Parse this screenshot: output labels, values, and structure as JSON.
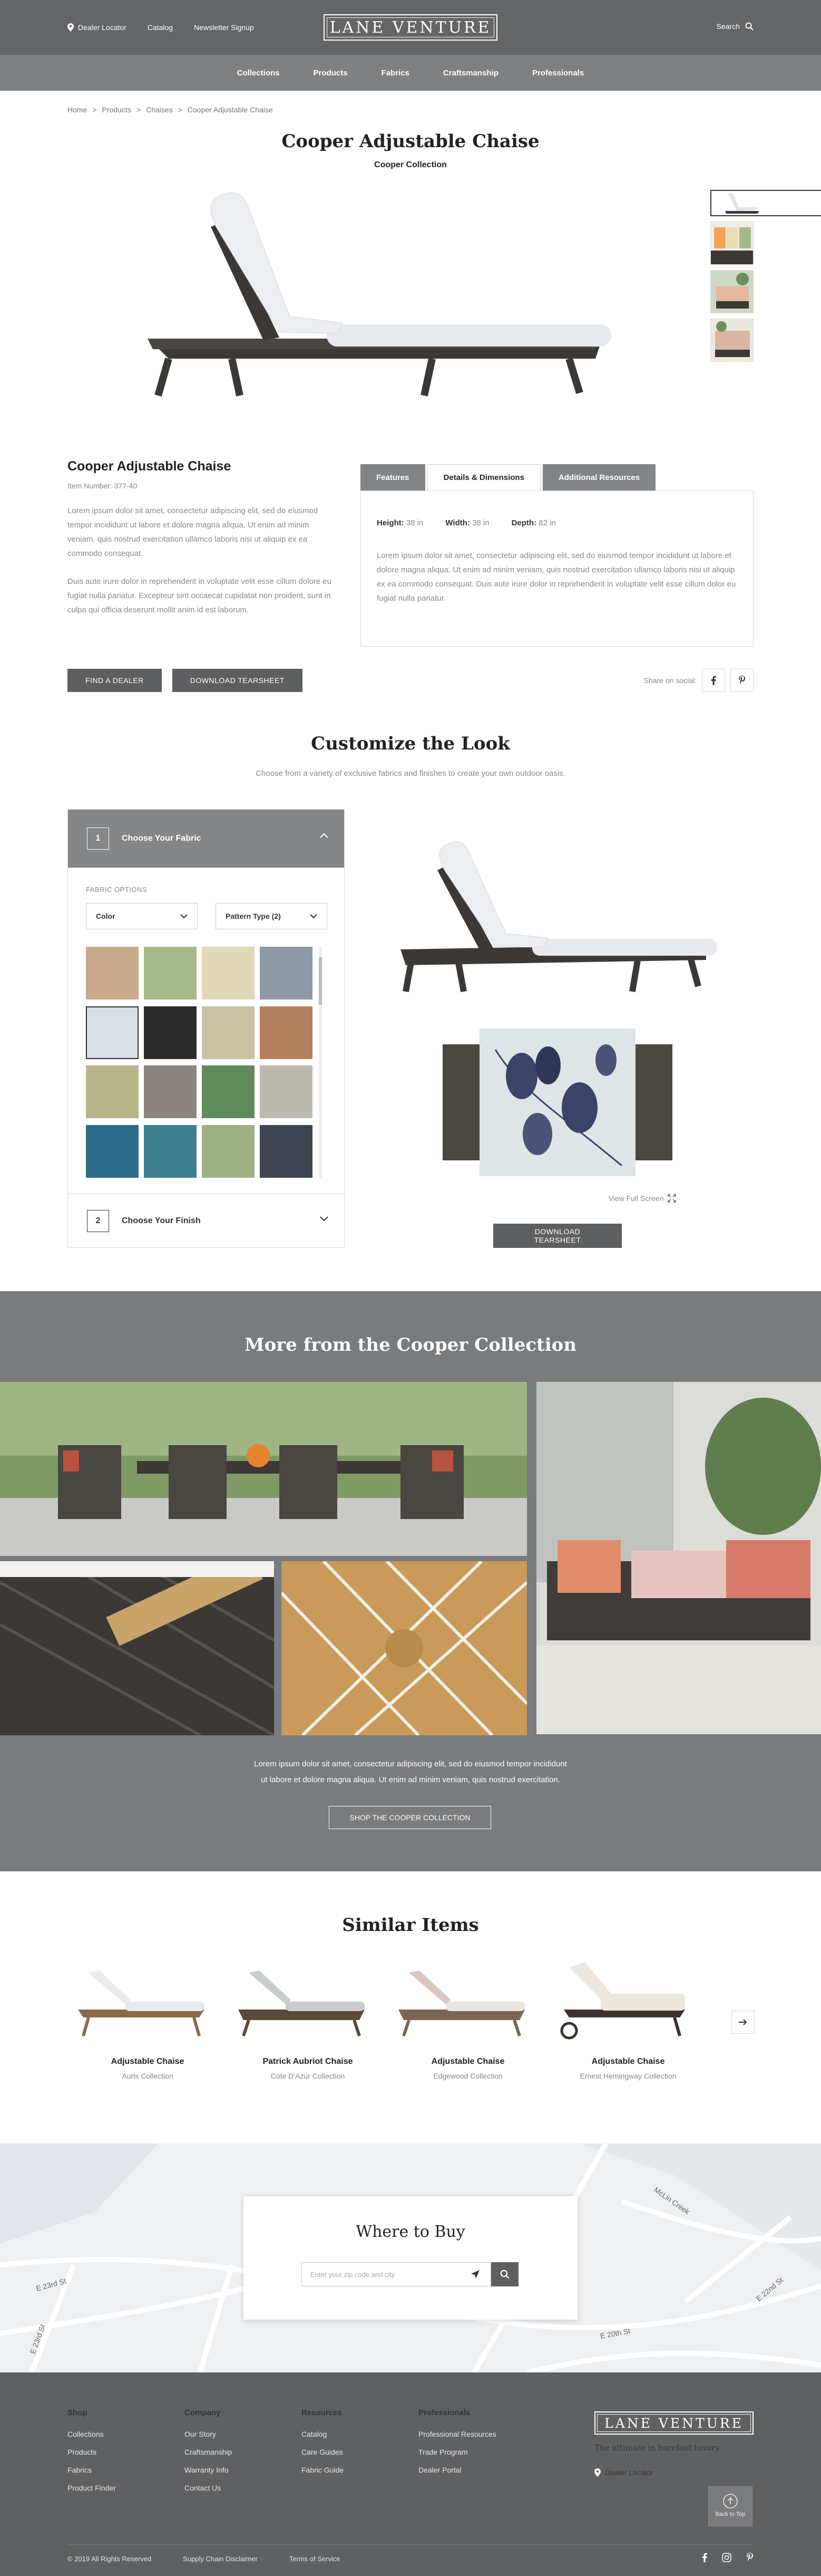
{
  "header": {
    "dealer_locator": "Dealer Locator",
    "catalog": "Catalog",
    "newsletter": "Newsletter Signup",
    "logo": "LANE VENTURE",
    "search": "Search"
  },
  "nav": [
    "Collections",
    "Products",
    "Fabrics",
    "Craftsmanship",
    "Professionals"
  ],
  "breadcrumb": [
    "Home",
    ">",
    "Products",
    ">",
    "Chaises",
    ">",
    "Cooper Adjustable Chaise"
  ],
  "product": {
    "title": "Cooper Adjustable Chaise",
    "collection": "Cooper Collection",
    "name": "Cooper Adjustable Chaise",
    "item_number": "Item Number: 377-40",
    "desc1": "Lorem ipsum dolor sit amet, consectetur adipiscing elit, sed do eiusmod tempor incididunt ut labore et dolore magna aliqua. Ut enim ad minim veniam, quis nostrud exercitation ullamco laboris nisi ut aliquip ex ea commodo consequat.",
    "desc2": "Duis aute irure dolor in reprehenderit in voluptate velit esse cillum dolore eu fugiat nulla pariatur. Excepteur sint occaecat cupidatat non proident, sunt in culpa qui officia deserunt mollit anim id est laborum.",
    "find_dealer": "FIND A DEALER",
    "download_tearsheet": "DOWNLOAD TEARSHEET",
    "share_label": "Share on social:"
  },
  "tabs": [
    "Features",
    "Details & Dimensions",
    "Additional Resources"
  ],
  "dimensions": {
    "height_label": "Height:",
    "height_value": "38 in",
    "width_label": "Width:",
    "width_value": "38 in",
    "depth_label": "Depth:",
    "depth_value": "82 in",
    "text": "Lorem ipsum dolor sit amet, consectetur adipiscing elit, sed do eiusmod tempor incididunt ut labore et dolore magna aliqua. Ut enim ad minim veniam, quis nostrud exercitation ullamco laboris nisi ut aliquip ex ea commodo consequat. Duis aute irure dolor in reprehenderit in voluptate velit esse cillum dolor eu fugiat nulla pariatur."
  },
  "customize": {
    "title": "Customize the Look",
    "subtitle": "Choose from a variety of exclusive fabrics and finishes to create your own outdoor oasis.",
    "step1_num": "1",
    "step1_label": "Choose Your Fabric",
    "fabric_options": "FABRIC OPTIONS",
    "color_select": "Color",
    "pattern_select": "Pattern Type (2)",
    "step2_num": "2",
    "step2_label": "Choose Your Finish",
    "view_fullscreen": "View Full Screen",
    "download_tearsheet": "DOWNLOAD TEARSHEET",
    "swatch_colors": [
      "#c9a98c",
      "#a7b98a",
      "#e1d8b8",
      "#8e99a8",
      "#d9dde4",
      "#2c2c2c",
      "#c8c1a3",
      "#b38060",
      "#b7b68a",
      "#8a8580",
      "#5e8a5c",
      "#bcb9ae",
      "#2e6c8a",
      "#3d7f8e",
      "#9fb084",
      "#3f4450"
    ]
  },
  "more": {
    "title": "More from the Cooper Collection",
    "text1": "Lorem ipsum dolor sit amet, consectetur adipiscing elit, sed do eiusmod tempor incididunt",
    "text2": "ut labore et dolore magna aliqua. Ut enim ad minim veniam, quis nostrud exercitation.",
    "button": "SHOP THE COOPER COLLECTION"
  },
  "similar": {
    "title": "Similar Items",
    "items": [
      {
        "name": "Adjustable Chaise",
        "collection": "Auris Collection"
      },
      {
        "name": "Patrick Aubriot Chaise",
        "collection": "Cote D'Azur Collection"
      },
      {
        "name": "Adjustable Chaise",
        "collection": "Edgewood Collection"
      },
      {
        "name": "Adjustable Chaise",
        "collection": "Ernest Hemingway Collection"
      }
    ]
  },
  "where": {
    "title": "Where to Buy",
    "placeholder": "Enter your zip code and city",
    "streets": [
      "McLin Creek",
      "E 23rd St",
      "E 22nd St",
      "E 20th St",
      "E 23rd St"
    ]
  },
  "footer": {
    "shop": {
      "title": "Shop",
      "items": [
        "Collections",
        "Products",
        "Fabrics",
        "Product Finder"
      ]
    },
    "company": {
      "title": "Company",
      "items": [
        "Our Story",
        "Craftsmanship",
        "Warranty Info",
        "Contact Us"
      ]
    },
    "resources": {
      "title": "Resources",
      "items": [
        "Catalog",
        "Care Guides",
        "Fabric Guide"
      ]
    },
    "professionals": {
      "title": "Professionals",
      "items": [
        "Professional Resources",
        "Trade Program",
        "Dealer Portal"
      ]
    },
    "logo": "LANE VENTURE",
    "tagline": "The ultimate in barefoot luxury.",
    "dealer_locator": "Dealer Locator",
    "back_to_top": "Back to Top",
    "copyright": "© 2019 All Rights Reserved",
    "supply_chain": "Supply Chain Disclaimer",
    "terms": "Terms of Service"
  }
}
